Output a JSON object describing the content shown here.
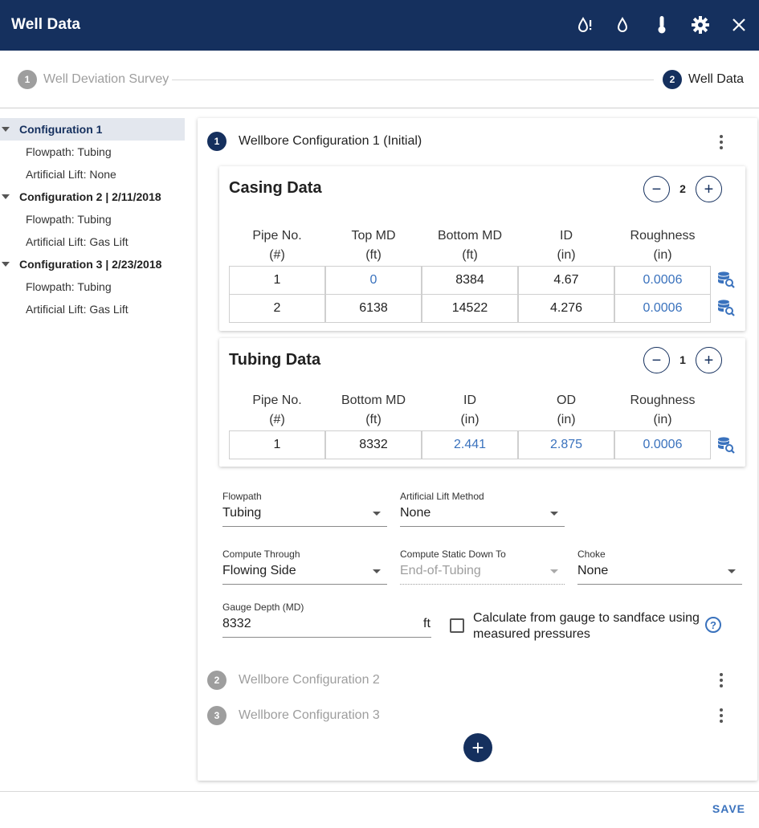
{
  "header": {
    "title": "Well Data",
    "icons": [
      "oil-alert-icon",
      "oil-drop-icon",
      "thermometer-icon",
      "gear-icon",
      "close-icon"
    ]
  },
  "stepper": {
    "step1": {
      "number": "1",
      "label": "Well Deviation Survey"
    },
    "step2": {
      "number": "2",
      "label": "Well Data"
    }
  },
  "tree": {
    "configs": [
      {
        "label": "Configuration 1",
        "children": [
          "Flowpath: Tubing",
          "Artificial Lift: None"
        ]
      },
      {
        "label": "Configuration 2 | 2/11/2018",
        "children": [
          "Flowpath: Tubing",
          "Artificial Lift: Gas Lift"
        ]
      },
      {
        "label": "Configuration 3 | 2/23/2018",
        "children": [
          "Flowpath: Tubing",
          "Artificial Lift: Gas Lift"
        ]
      }
    ]
  },
  "wellbores": [
    {
      "number": "1",
      "title": "Wellbore Configuration 1 (Initial)"
    },
    {
      "number": "2",
      "title": "Wellbore Configuration 2"
    },
    {
      "number": "3",
      "title": "Wellbore Configuration 3"
    }
  ],
  "casing": {
    "title": "Casing Data",
    "count": "2",
    "headers": [
      [
        "Pipe No.",
        "(#)"
      ],
      [
        "Top MD",
        "(ft)"
      ],
      [
        "Bottom MD",
        "(ft)"
      ],
      [
        "ID",
        "(in)"
      ],
      [
        "Roughness",
        "(in)"
      ]
    ],
    "rows": [
      [
        "1",
        "0",
        "8384",
        "4.67",
        "0.0006"
      ],
      [
        "2",
        "6138",
        "14522",
        "4.276",
        "0.0006"
      ]
    ]
  },
  "tubing": {
    "title": "Tubing Data",
    "count": "1",
    "headers": [
      [
        "Pipe No.",
        "(#)"
      ],
      [
        "Bottom MD",
        "(ft)"
      ],
      [
        "ID",
        "(in)"
      ],
      [
        "OD",
        "(in)"
      ],
      [
        "Roughness",
        "(in)"
      ]
    ],
    "rows": [
      [
        "1",
        "8332",
        "2.441",
        "2.875",
        "0.0006"
      ]
    ]
  },
  "form": {
    "flowpath": {
      "label": "Flowpath",
      "value": "Tubing"
    },
    "artificial_lift": {
      "label": "Artificial Lift Method",
      "value": "None"
    },
    "compute_through": {
      "label": "Compute Through",
      "value": "Flowing Side"
    },
    "compute_static": {
      "label": "Compute Static Down To",
      "value": "End-of-Tubing"
    },
    "choke": {
      "label": "Choke",
      "value": "None"
    },
    "gauge_depth": {
      "label": "Gauge Depth (MD)",
      "value": "8332",
      "unit": "ft"
    },
    "calc_checkbox": {
      "line1": "Calculate from gauge to sandface using",
      "line2": "measured pressures",
      "checked": false
    }
  },
  "footer": {
    "save_label": "SAVE"
  },
  "colors": {
    "primary": "#15305e",
    "link": "#3a72bd",
    "inactive": "#9e9e9e"
  }
}
